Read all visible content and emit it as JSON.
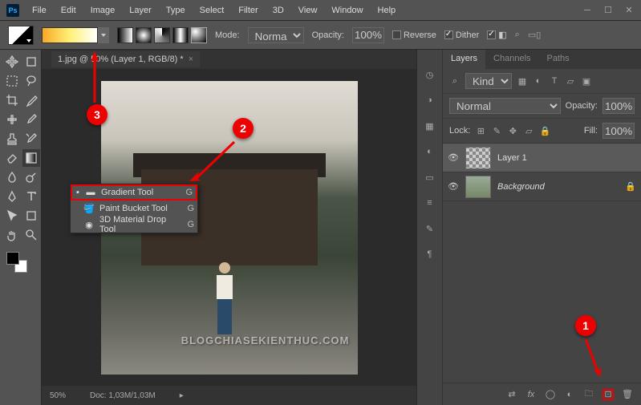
{
  "app": {
    "logo": "Ps"
  },
  "menu": [
    "File",
    "Edit",
    "Image",
    "Layer",
    "Type",
    "Select",
    "Filter",
    "3D",
    "View",
    "Window",
    "Help"
  ],
  "options": {
    "mode_label": "Mode:",
    "mode_value": "Normal",
    "opacity_label": "Opacity:",
    "opacity_value": "100%",
    "reverse": "Reverse",
    "dither": "Dither"
  },
  "document": {
    "tab": "1.jpg @ 50% (Layer 1, RGB/8) *",
    "zoom": "50%",
    "doc_size": "Doc: 1,03M/1,03M",
    "watermark": "BLOGCHIASEKIENTHUC.COM"
  },
  "flyout": [
    {
      "label": "Gradient Tool",
      "key": "G",
      "selected": true,
      "icon": "gradient"
    },
    {
      "label": "Paint Bucket Tool",
      "key": "G",
      "selected": false,
      "icon": "bucket"
    },
    {
      "label": "3D Material Drop Tool",
      "key": "G",
      "selected": false,
      "icon": "3d-drop"
    }
  ],
  "panels": {
    "tabs": [
      "Layers",
      "Channels",
      "Paths"
    ],
    "kind": "Kind",
    "blend": "Normal",
    "opacity_label": "Opacity:",
    "opacity": "100%",
    "lock_label": "Lock:",
    "fill_label": "Fill:",
    "fill": "100%",
    "layers": [
      {
        "name": "Layer 1",
        "visible": true,
        "locked": false,
        "selected": true,
        "thumb": "transparent"
      },
      {
        "name": "Background",
        "visible": true,
        "locked": true,
        "selected": false,
        "thumb": "image",
        "italic": true
      }
    ]
  },
  "callouts": {
    "c1": "1",
    "c2": "2",
    "c3": "3"
  }
}
